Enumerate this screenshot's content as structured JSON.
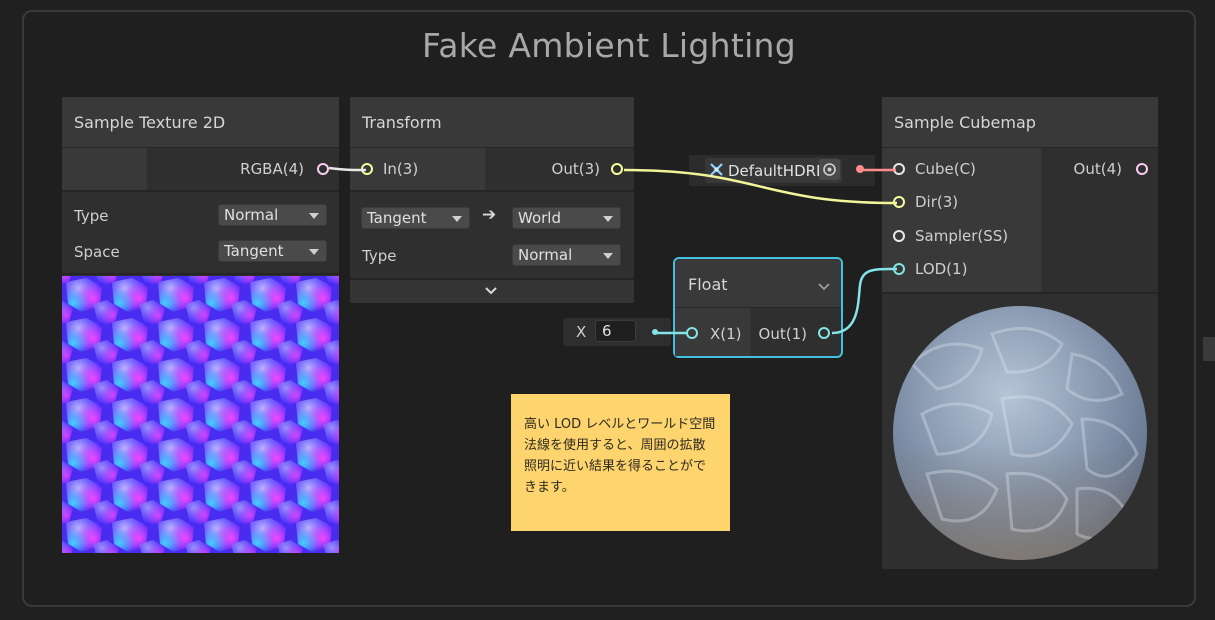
{
  "graph": {
    "group_title": "Fake Ambient Lighting"
  },
  "nodes": {
    "sample_texture_2d": {
      "title": "Sample Texture 2D",
      "outputs": [
        {
          "label": "RGBA(4)"
        }
      ],
      "fields": [
        {
          "label": "Type",
          "value": "Normal"
        },
        {
          "label": "Space",
          "value": "Tangent"
        }
      ],
      "preview": "normal-map-preview"
    },
    "transform": {
      "title": "Transform",
      "inputs": [
        {
          "label": "In(3)"
        }
      ],
      "outputs": [
        {
          "label": "Out(3)"
        }
      ],
      "from_space": "Tangent",
      "to_space": "World",
      "type_label": "Type",
      "type_value": "Normal"
    },
    "default_hdri": {
      "label": "DefaultHDRI"
    },
    "sample_cubemap": {
      "title": "Sample Cubemap",
      "inputs": [
        {
          "label": "Cube(C)"
        },
        {
          "label": "Dir(3)"
        },
        {
          "label": "Sampler(SS)"
        },
        {
          "label": "LOD(1)"
        }
      ],
      "outputs": [
        {
          "label": "Out(4)"
        }
      ],
      "preview": "cubemap-sphere-preview"
    },
    "float": {
      "title": "Float",
      "inputs": [
        {
          "label": "X(1)"
        }
      ],
      "outputs": [
        {
          "label": "Out(1)"
        }
      ],
      "inline_input": {
        "label": "X",
        "value": "6"
      }
    }
  },
  "sticky_note": {
    "lines": [
      "高い LOD レベルとワールド空間",
      "法線を使用すると、周囲の拡散",
      "照明に近い結果を得ることがで",
      "きます。"
    ],
    "color": "#fdd46d"
  },
  "colors": {
    "background": "#202020",
    "vector3_port": "#f6ff9a",
    "vector4_port": "#fbcbf4",
    "float_port": "#84e4e7",
    "cubemap_port": "#ff8b8b",
    "selection": "#44c0e0"
  }
}
